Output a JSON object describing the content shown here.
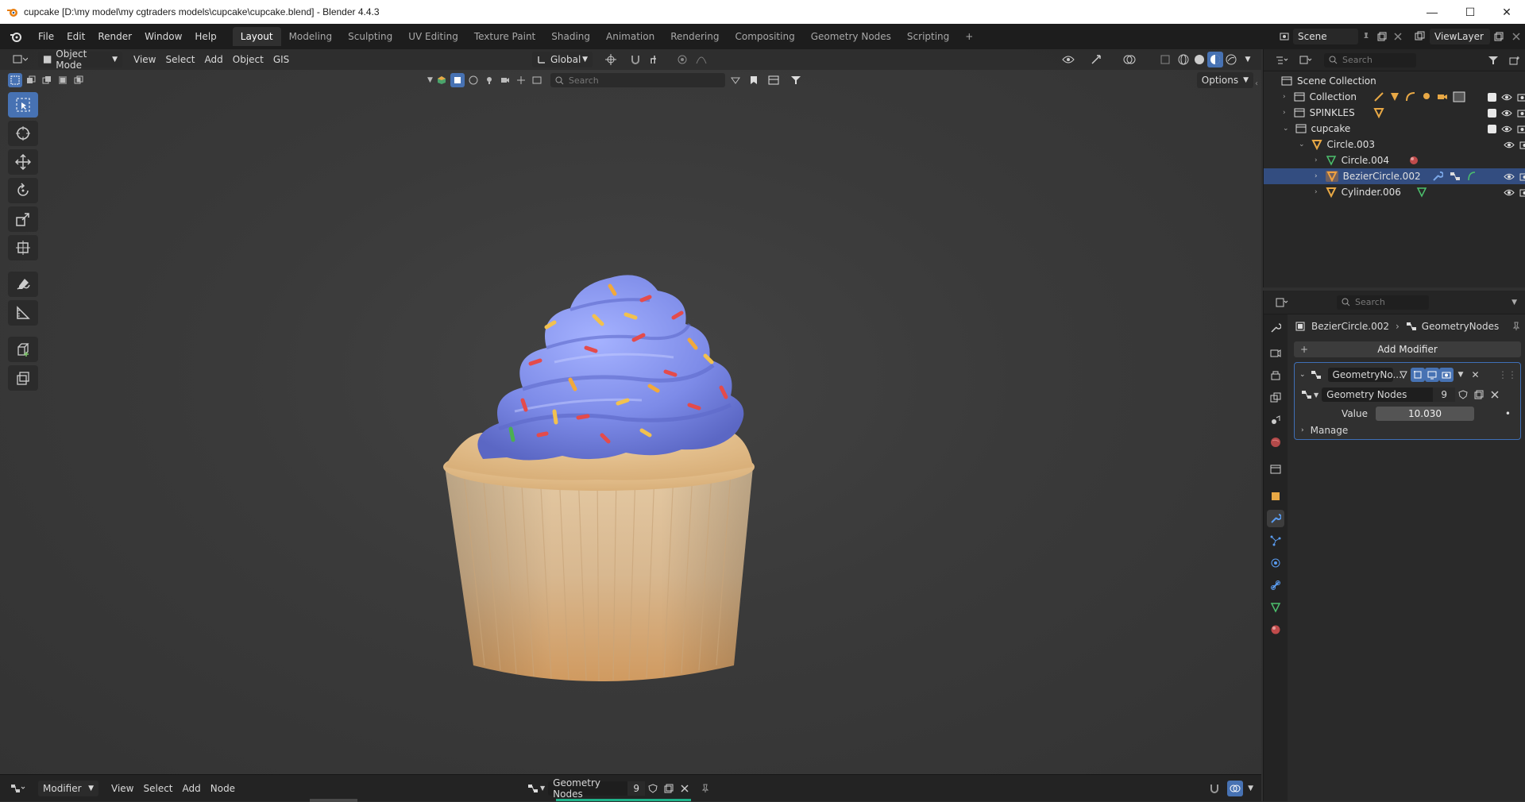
{
  "window": {
    "title": "cupcake [D:\\my model\\my cgtraders models\\cupcake\\cupcake.blend] - Blender 4.4.3",
    "controls": {
      "minimize": "—",
      "maximize": "☐",
      "close": "✕"
    }
  },
  "menubar": {
    "items": [
      "File",
      "Edit",
      "Render",
      "Window",
      "Help"
    ]
  },
  "workspaces": {
    "tabs": [
      "Layout",
      "Modeling",
      "Sculpting",
      "UV Editing",
      "Texture Paint",
      "Shading",
      "Animation",
      "Rendering",
      "Compositing",
      "Geometry Nodes",
      "Scripting"
    ],
    "active_index": 0,
    "add": "+"
  },
  "scene": {
    "name": "Scene",
    "viewlayer": "ViewLayer"
  },
  "viewport": {
    "mode": "Object Mode",
    "menus": [
      "View",
      "Select",
      "Add",
      "Object",
      "GIS"
    ],
    "transform_orientation": "Global",
    "search_placeholder": "Search",
    "options": "Options"
  },
  "outliner": {
    "search_placeholder": "Search",
    "rows": [
      {
        "label": "Scene Collection",
        "depth": 0,
        "type": "scene"
      },
      {
        "label": "Collection",
        "depth": 1,
        "type": "collection"
      },
      {
        "label": "SPINKLES",
        "depth": 1,
        "type": "collection"
      },
      {
        "label": "cupcake",
        "depth": 1,
        "type": "collection"
      },
      {
        "label": "Circle.003",
        "depth": 2,
        "type": "object"
      },
      {
        "label": "Circle.004",
        "depth": 3,
        "type": "mesh"
      },
      {
        "label": "BezierCircle.002",
        "depth": 3,
        "type": "object",
        "selected": true
      },
      {
        "label": "Cylinder.006",
        "depth": 3,
        "type": "object"
      }
    ]
  },
  "properties": {
    "search_placeholder": "Search",
    "breadcrumb": {
      "object": "BezierCircle.002",
      "modifier": "GeometryNodes"
    },
    "add_modifier": "Add Modifier",
    "modifier": {
      "name": "GeometryNo...",
      "node_group": "Geometry Nodes",
      "users": "9",
      "value_label": "Value",
      "value": "10.030",
      "manage": "Manage"
    }
  },
  "node_editor": {
    "type": "Modifier",
    "menus": [
      "View",
      "Select",
      "Add",
      "Node"
    ],
    "node_group": "Geometry Nodes",
    "users": "9"
  }
}
